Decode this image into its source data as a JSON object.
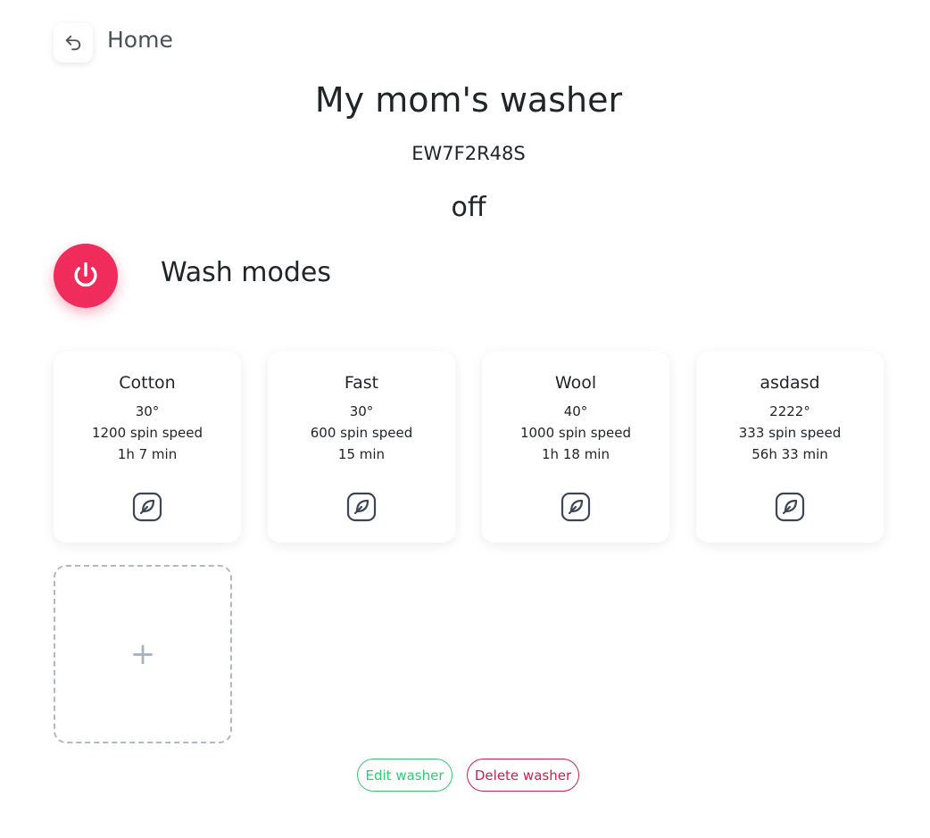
{
  "header": {
    "back_label": "Home",
    "back_icon": "undo-arrow-icon"
  },
  "washer": {
    "name": "My mom's washer",
    "serial": "EW7F2R48S",
    "status": "off"
  },
  "power": {
    "icon": "power-icon",
    "color": "#ef2c5b"
  },
  "wash_modes": {
    "title": "Wash modes",
    "items": [
      {
        "name": "Cotton",
        "temperature": "30°",
        "spin": "1200 spin speed",
        "duration": "1h 7 min"
      },
      {
        "name": "Fast",
        "temperature": "30°",
        "spin": "600 spin speed",
        "duration": "15 min"
      },
      {
        "name": "Wool",
        "temperature": "40°",
        "spin": "1000 spin speed",
        "duration": "1h 18 min"
      },
      {
        "name": "asdasd",
        "temperature": "2222°",
        "spin": "333 spin speed",
        "duration": "56h 33 min"
      }
    ],
    "edit_icon": "edit-pen-icon",
    "add_label": "+"
  },
  "actions": {
    "edit_label": "Edit washer",
    "delete_label": "Delete washer",
    "edit_color": "#2ecc71",
    "delete_color": "#d11f4b"
  }
}
